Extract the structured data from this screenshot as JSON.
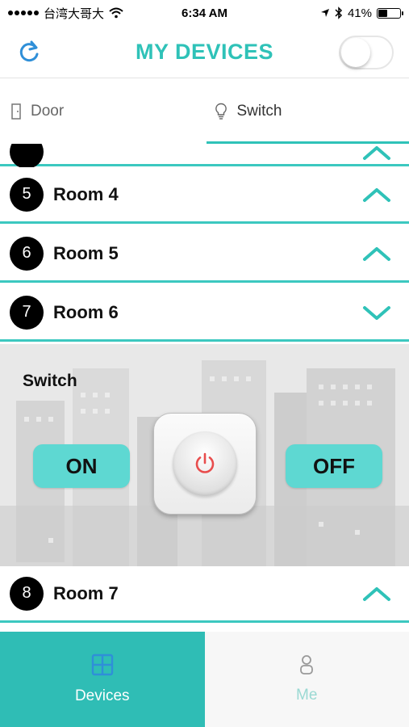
{
  "status_bar": {
    "carrier": "台湾大哥大",
    "time": "6:34 AM",
    "battery": "41%",
    "battery_level": 0.41
  },
  "nav": {
    "title": "MY DEVICES",
    "toggle_on": false,
    "icons": {
      "refresh": "refresh-icon"
    }
  },
  "tabs": [
    {
      "label": "Door",
      "icon": "door-icon",
      "active": false
    },
    {
      "label": "Switch",
      "icon": "lightbulb-icon",
      "active": true
    }
  ],
  "rooms": [
    {
      "number": "5",
      "name": "Room 4",
      "expanded": false
    },
    {
      "number": "6",
      "name": "Room 5",
      "expanded": false
    },
    {
      "number": "7",
      "name": "Room 6",
      "expanded": true
    },
    {
      "number": "8",
      "name": "Room 7",
      "expanded": false
    }
  ],
  "switch_panel": {
    "title": "Switch",
    "on_label": "ON",
    "off_label": "OFF"
  },
  "bottom_tabs": [
    {
      "label": "Devices",
      "icon": "grid-icon",
      "active": true
    },
    {
      "label": "Me",
      "icon": "person-icon",
      "active": false
    }
  ],
  "colors": {
    "accent": "#2fc2b8",
    "pill": "#5ed8d2",
    "power_icon": "#e84d4d",
    "bottom_active": "#2fbdb5"
  }
}
